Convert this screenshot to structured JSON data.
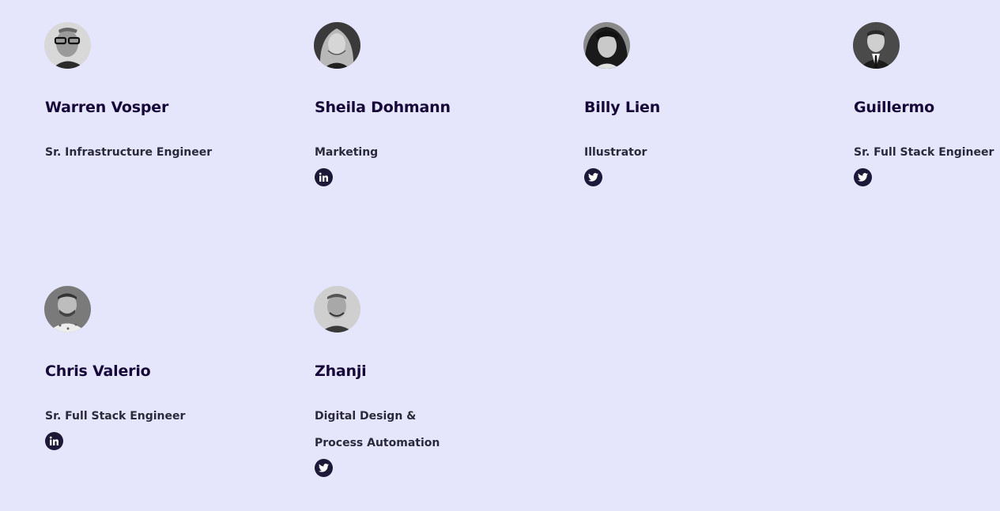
{
  "team": {
    "members": [
      {
        "name": "Warren Vosper",
        "role": "Sr. Infrastructure Engineer",
        "social": null
      },
      {
        "name": "Sheila Dohmann",
        "role": "Marketing",
        "social": "linkedin-icon"
      },
      {
        "name": "Billy Lien",
        "role": "Illustrator",
        "social": "twitter-icon"
      },
      {
        "name": "Guillermo",
        "role": "Sr. Full Stack Engineer",
        "social": "twitter-icon"
      },
      {
        "name": "Chris Valerio",
        "role": "Sr. Full Stack Engineer",
        "social": "linkedin-icon"
      },
      {
        "name": "Zhanji",
        "role": "Digital Design & Process Automation",
        "social": "twitter-icon"
      }
    ]
  },
  "colors": {
    "background": "#e5e5fc",
    "name_text": "#16083a",
    "role_text": "#2a2a3a",
    "social_icon_bg": "#1b1838"
  }
}
